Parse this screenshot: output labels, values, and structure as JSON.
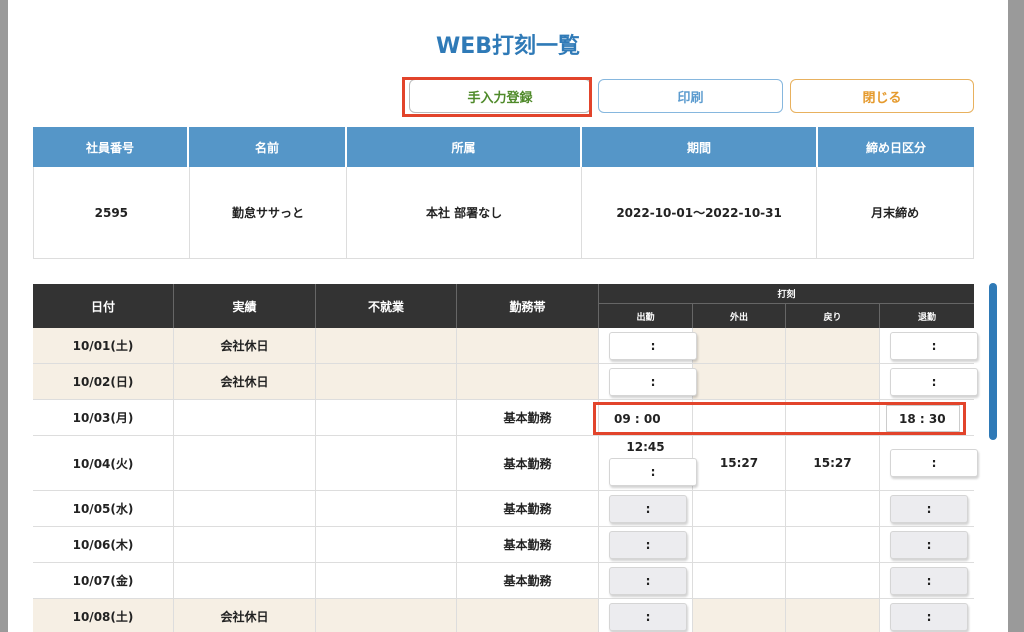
{
  "title": "WEB打刻一覧",
  "buttons": {
    "manual": "手入力登録",
    "print": "印刷",
    "close": "閉じる"
  },
  "info": {
    "headers": [
      "社員番号",
      "名前",
      "所属",
      "期間",
      "締め日区分"
    ],
    "values": [
      "2595",
      "勤怠ササっと",
      "本社 部署なし",
      "2022-10-01〜2022-10-31",
      "月末締め"
    ]
  },
  "attendance": {
    "headers": {
      "date": "日付",
      "result": "実績",
      "absence": "不就業",
      "shift": "勤務帯",
      "stamp": "打刻",
      "in": "出勤",
      "out_go": "外出",
      "back": "戻り",
      "leave": "退勤"
    },
    "rows": [
      {
        "date": "10/01(土)",
        "result": "会社休日",
        "shift": "",
        "in": ":",
        "out_go": "",
        "back": "",
        "leave": ":"
      },
      {
        "date": "10/02(日)",
        "result": "会社休日",
        "shift": "",
        "in": ":",
        "out_go": "",
        "back": "",
        "leave": ":"
      },
      {
        "date": "10/03(月)",
        "result": "",
        "shift": "基本勤務",
        "in": "09 : 00",
        "out_go": "",
        "back": "",
        "leave": "18 : 30"
      },
      {
        "date": "10/04(火)",
        "result": "",
        "shift": "基本勤務",
        "in_top": "12:45",
        "in": ":",
        "out_go": "15:27",
        "back": "15:27",
        "leave": ":"
      },
      {
        "date": "10/05(水)",
        "result": "",
        "shift": "基本勤務",
        "in": ":",
        "out_go": "",
        "back": "",
        "leave": ":"
      },
      {
        "date": "10/06(木)",
        "result": "",
        "shift": "基本勤務",
        "in": ":",
        "out_go": "",
        "back": "",
        "leave": ":"
      },
      {
        "date": "10/07(金)",
        "result": "",
        "shift": "基本勤務",
        "in": ":",
        "out_go": "",
        "back": "",
        "leave": ":"
      },
      {
        "date": "10/08(土)",
        "result": "会社休日",
        "shift": "",
        "in": ":",
        "out_go": "",
        "back": "",
        "leave": ":"
      }
    ]
  }
}
